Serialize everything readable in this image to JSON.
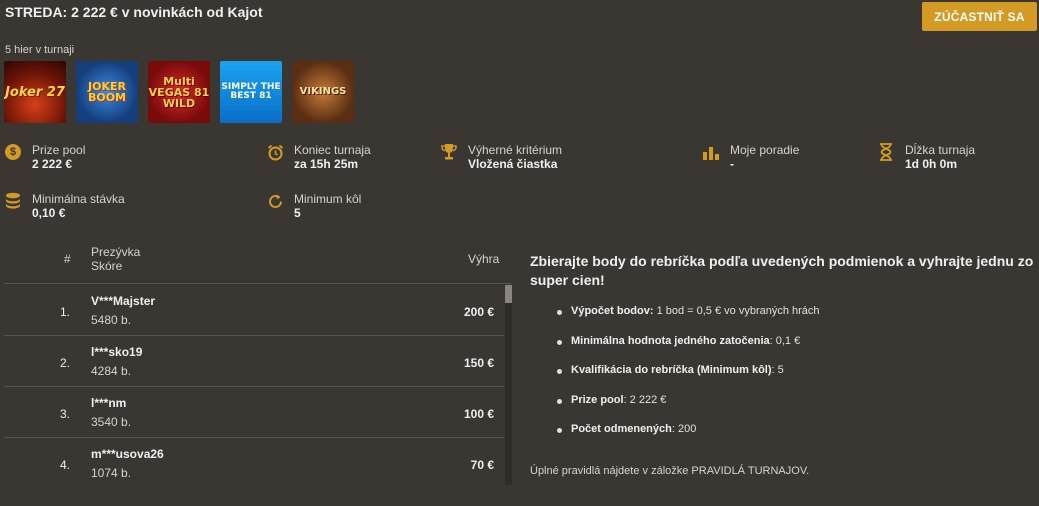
{
  "header": {
    "title": "STREDA: 2 222 € v novinkách od Kajot",
    "join_label": "ZÚČASTNIŤ SA"
  },
  "games": {
    "label": "5 hier v turnaji",
    "items": [
      {
        "name": "Joker 27"
      },
      {
        "name": "JOKER BOOM"
      },
      {
        "name": "Multi VEGAS 81 WILD"
      },
      {
        "name": "SIMPLY THE BEST 81"
      },
      {
        "name": "VIKINGS"
      }
    ]
  },
  "stats": {
    "prize_pool": {
      "label": "Prize pool",
      "value": "2 222 €",
      "icon": "dollar-coin-icon"
    },
    "end": {
      "label": "Koniec turnaja",
      "value": "za 15h 25m",
      "icon": "alarm-clock-icon"
    },
    "criterion": {
      "label": "Výherné kritérium",
      "value": "Vložená čiastka",
      "icon": "trophy-icon"
    },
    "my_rank": {
      "label": "Moje poradie",
      "value": "-",
      "icon": "bar-chart-icon"
    },
    "duration": {
      "label": "Dĺžka turnaja",
      "value": "1d 0h 0m",
      "icon": "hourglass-icon"
    },
    "min_bet": {
      "label": "Minimálna stávka",
      "value": "0,10 €",
      "icon": "coin-stack-icon"
    },
    "min_rounds": {
      "label": "Minimum kôl",
      "value": "5",
      "icon": "refresh-icon"
    }
  },
  "leaderboard": {
    "col_rank": "#",
    "col_nick": "Prezývka",
    "col_score": "Skóre",
    "col_prize": "Výhra",
    "rows": [
      {
        "rank": "1.",
        "nick": "V***Majster",
        "score": "5480 b.",
        "prize": "200 €"
      },
      {
        "rank": "2.",
        "nick": "l***sko19",
        "score": "4284 b.",
        "prize": "150 €"
      },
      {
        "rank": "3.",
        "nick": "l***nm",
        "score": "3540 b.",
        "prize": "100 €"
      },
      {
        "rank": "4.",
        "nick": "m***usova26",
        "score": "1074 b.",
        "prize": "70 €"
      }
    ]
  },
  "info": {
    "heading": "Zbierajte body do rebríčka podľa uvedených podmienok a vyhrajte jednu zo super cien!",
    "rules": [
      {
        "key": "Výpočet bodov:",
        "val": " 1 bod = 0,5 € vo vybraných hrách"
      },
      {
        "key": "Minimálna hodnota jedného zatočenia",
        "val": ": 0,1 €"
      },
      {
        "key": "Kvalifikácia do rebríčka (Minimum kôl)",
        "val": ": 5"
      },
      {
        "key": "Prize pool",
        "val": ": 2 222 €"
      },
      {
        "key": "Počet odmenených",
        "val": ": 200"
      }
    ],
    "footer": "Úplné pravidlá nájdete v záložke PRAVIDLÁ TURNAJOV."
  },
  "colors": {
    "accent": "#d39a24",
    "background": "#3a3733"
  }
}
